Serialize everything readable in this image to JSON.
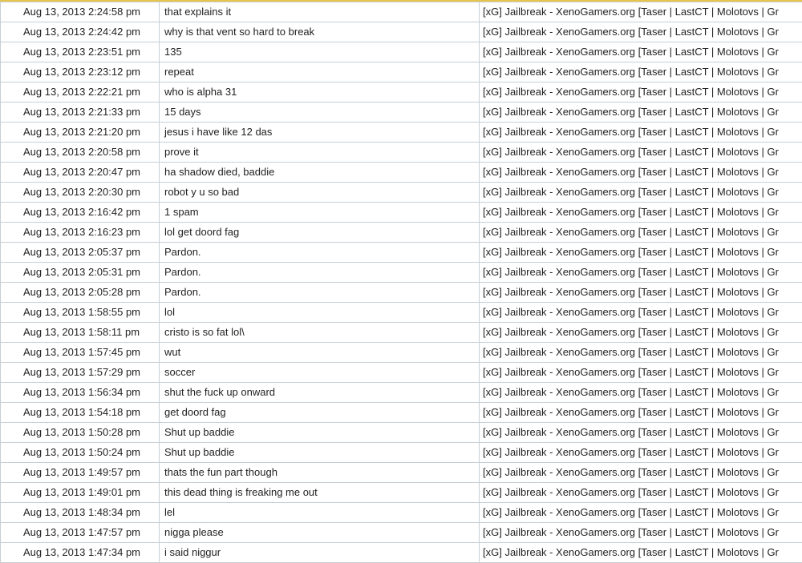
{
  "rows": [
    {
      "time": "Aug 13, 2013 2:24:58 pm",
      "message": "that explains it",
      "server": "[xG] Jailbreak - XenoGamers.org [Taser | LastCT | Molotovs | Gr"
    },
    {
      "time": "Aug 13, 2013 2:24:42 pm",
      "message": "why is that vent so hard to break",
      "server": "[xG] Jailbreak - XenoGamers.org [Taser | LastCT | Molotovs | Gr"
    },
    {
      "time": "Aug 13, 2013 2:23:51 pm",
      "message": "135",
      "server": "[xG] Jailbreak - XenoGamers.org [Taser | LastCT | Molotovs | Gr"
    },
    {
      "time": "Aug 13, 2013 2:23:12 pm",
      "message": "repeat",
      "server": "[xG] Jailbreak - XenoGamers.org [Taser | LastCT | Molotovs | Gr"
    },
    {
      "time": "Aug 13, 2013 2:22:21 pm",
      "message": "who is alpha 31",
      "server": "[xG] Jailbreak - XenoGamers.org [Taser | LastCT | Molotovs | Gr"
    },
    {
      "time": "Aug 13, 2013 2:21:33 pm",
      "message": "15 days",
      "server": "[xG] Jailbreak - XenoGamers.org [Taser | LastCT | Molotovs | Gr"
    },
    {
      "time": "Aug 13, 2013 2:21:20 pm",
      "message": "jesus i have like 12 das",
      "server": "[xG] Jailbreak - XenoGamers.org [Taser | LastCT | Molotovs | Gr"
    },
    {
      "time": "Aug 13, 2013 2:20:58 pm",
      "message": "prove it",
      "server": "[xG] Jailbreak - XenoGamers.org [Taser | LastCT | Molotovs | Gr"
    },
    {
      "time": "Aug 13, 2013 2:20:47 pm",
      "message": "ha shadow died, baddie",
      "server": "[xG] Jailbreak - XenoGamers.org [Taser | LastCT | Molotovs | Gr"
    },
    {
      "time": "Aug 13, 2013 2:20:30 pm",
      "message": "robot y u so bad",
      "server": "[xG] Jailbreak - XenoGamers.org [Taser | LastCT | Molotovs | Gr"
    },
    {
      "time": "Aug 13, 2013 2:16:42 pm",
      "message": "1 spam",
      "server": "[xG] Jailbreak - XenoGamers.org [Taser | LastCT | Molotovs | Gr"
    },
    {
      "time": "Aug 13, 2013 2:16:23 pm",
      "message": "lol get doord fag",
      "server": "[xG] Jailbreak - XenoGamers.org [Taser | LastCT | Molotovs | Gr"
    },
    {
      "time": "Aug 13, 2013 2:05:37 pm",
      "message": "Pardon.",
      "server": "[xG] Jailbreak - XenoGamers.org [Taser | LastCT | Molotovs | Gr"
    },
    {
      "time": "Aug 13, 2013 2:05:31 pm",
      "message": "Pardon.",
      "server": "[xG] Jailbreak - XenoGamers.org [Taser | LastCT | Molotovs | Gr"
    },
    {
      "time": "Aug 13, 2013 2:05:28 pm",
      "message": "Pardon.",
      "server": "[xG] Jailbreak - XenoGamers.org [Taser | LastCT | Molotovs | Gr"
    },
    {
      "time": "Aug 13, 2013 1:58:55 pm",
      "message": "lol",
      "server": "[xG] Jailbreak - XenoGamers.org [Taser | LastCT | Molotovs | Gr"
    },
    {
      "time": "Aug 13, 2013 1:58:11 pm",
      "message": "cristo is so fat lol\\",
      "server": "[xG] Jailbreak - XenoGamers.org [Taser | LastCT | Molotovs | Gr"
    },
    {
      "time": "Aug 13, 2013 1:57:45 pm",
      "message": "wut",
      "server": "[xG] Jailbreak - XenoGamers.org [Taser | LastCT | Molotovs | Gr"
    },
    {
      "time": "Aug 13, 2013 1:57:29 pm",
      "message": "soccer",
      "server": "[xG] Jailbreak - XenoGamers.org [Taser | LastCT | Molotovs | Gr"
    },
    {
      "time": "Aug 13, 2013 1:56:34 pm",
      "message": "shut the fuck up onward",
      "server": "[xG] Jailbreak - XenoGamers.org [Taser | LastCT | Molotovs | Gr"
    },
    {
      "time": "Aug 13, 2013 1:54:18 pm",
      "message": "get doord fag",
      "server": "[xG] Jailbreak - XenoGamers.org [Taser | LastCT | Molotovs | Gr"
    },
    {
      "time": "Aug 13, 2013 1:50:28 pm",
      "message": "Shut up baddie",
      "server": "[xG] Jailbreak - XenoGamers.org [Taser | LastCT | Molotovs | Gr"
    },
    {
      "time": "Aug 13, 2013 1:50:24 pm",
      "message": "Shut up baddie",
      "server": "[xG] Jailbreak - XenoGamers.org [Taser | LastCT | Molotovs | Gr"
    },
    {
      "time": "Aug 13, 2013 1:49:57 pm",
      "message": "thats the fun part though",
      "server": "[xG] Jailbreak - XenoGamers.org [Taser | LastCT | Molotovs | Gr"
    },
    {
      "time": "Aug 13, 2013 1:49:01 pm",
      "message": "this dead thing is freaking me out",
      "server": "[xG] Jailbreak - XenoGamers.org [Taser | LastCT | Molotovs | Gr"
    },
    {
      "time": "Aug 13, 2013 1:48:34 pm",
      "message": "lel",
      "server": "[xG] Jailbreak - XenoGamers.org [Taser | LastCT | Molotovs | Gr"
    },
    {
      "time": "Aug 13, 2013 1:47:57 pm",
      "message": "nigga please",
      "server": "[xG] Jailbreak - XenoGamers.org [Taser | LastCT | Molotovs | Gr"
    },
    {
      "time": "Aug 13, 2013 1:47:34 pm",
      "message": "i said niggur",
      "server": "[xG] Jailbreak - XenoGamers.org [Taser | LastCT | Molotovs | Gr"
    }
  ],
  "colors": {
    "border": "#c6cfd6",
    "accent_top": "#e6c64a",
    "text": "#222222",
    "background": "#ffffff"
  }
}
